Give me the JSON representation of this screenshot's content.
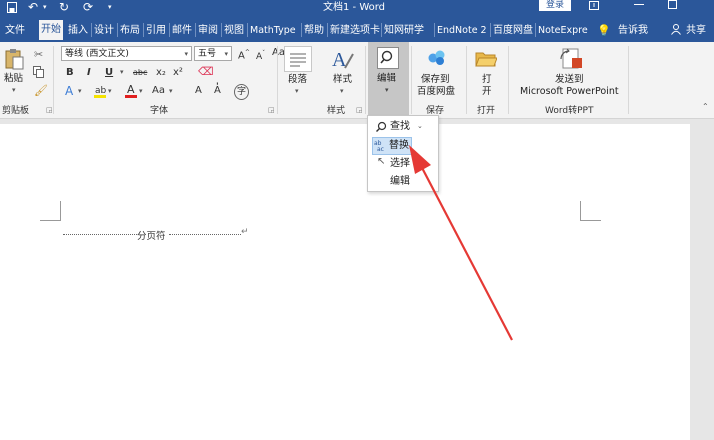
{
  "titlebar": {
    "doc_title": "文档1 - Word",
    "login_label": "登录"
  },
  "tabs": [
    {
      "label": "文件"
    },
    {
      "label": "开始"
    },
    {
      "label": "插入"
    },
    {
      "label": "设计"
    },
    {
      "label": "布局"
    },
    {
      "label": "引用"
    },
    {
      "label": "邮件"
    },
    {
      "label": "审阅"
    },
    {
      "label": "视图"
    },
    {
      "label": "MathType"
    },
    {
      "label": "帮助"
    },
    {
      "label": "新建选项卡"
    },
    {
      "label": "知网研学"
    },
    {
      "label": "EndNote 2"
    },
    {
      "label": "百度网盘"
    },
    {
      "label": "NoteExpre"
    }
  ],
  "tell_me": "告诉我",
  "share": "共享",
  "ribbon": {
    "paste_label": "粘贴",
    "clipboard_label": "剪贴板",
    "font_name": "等线 (西文正文)",
    "font_size": "五号",
    "font_group_label": "字体",
    "paragraph_label": "段落",
    "styles_label": "样式",
    "styles_group_label": "样式",
    "edit_label": "编辑",
    "save_baidu_line1": "保存到",
    "save_baidu_line2": "百度网盘",
    "save_group_label": "保存",
    "open_label1": "打",
    "open_label2": "开",
    "open_group_label": "打开",
    "send_line1": "发送到",
    "send_line2": "Microsoft PowerPoint",
    "word2ppt_label": "Word转PPT",
    "font_buttons": [
      "B",
      "I",
      "U",
      "abc",
      "x₂",
      "x²"
    ]
  },
  "document": {
    "page_break_text": "分页符"
  },
  "dropdown": {
    "find_label": "查找",
    "replace_label": "替换",
    "select_label": "选择",
    "edit_label": "编辑"
  },
  "colors": {
    "word_blue": "#2b579a",
    "arrow_red": "#e53935",
    "highlight": "#cfe3f7"
  }
}
